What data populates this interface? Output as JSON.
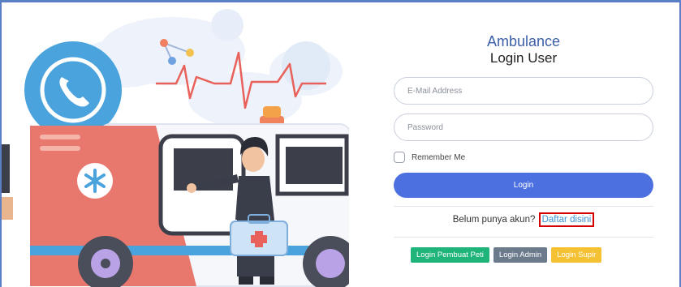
{
  "header": {
    "brand": "Ambulance",
    "subtitle": "Login User"
  },
  "form": {
    "email_placeholder": "E-Mail Address",
    "password_placeholder": "Password",
    "remember_label": "Remember Me",
    "login_label": "Login"
  },
  "register": {
    "prompt": "Belum punya akun?",
    "link_label": "Daftar disini"
  },
  "roles": {
    "pembuat_peti_label": "Login Pembuat Peti",
    "admin_label": "Login Admin",
    "supir_label": "Login Supir"
  },
  "colors": {
    "primary": "#4d70e0",
    "brand_text": "#3b5fa8",
    "link": "#3b8fd1",
    "highlight_box": "#d50000",
    "pembuat_peti": "#1fb47a",
    "admin": "#6b7b8c",
    "supir": "#f4c133"
  },
  "illustration": {
    "subject": "ambulance-with-paramedic",
    "icons": [
      "phone-icon",
      "heartbeat-icon",
      "medical-star-icon",
      "first-aid-kit-icon",
      "siren-icon"
    ]
  }
}
